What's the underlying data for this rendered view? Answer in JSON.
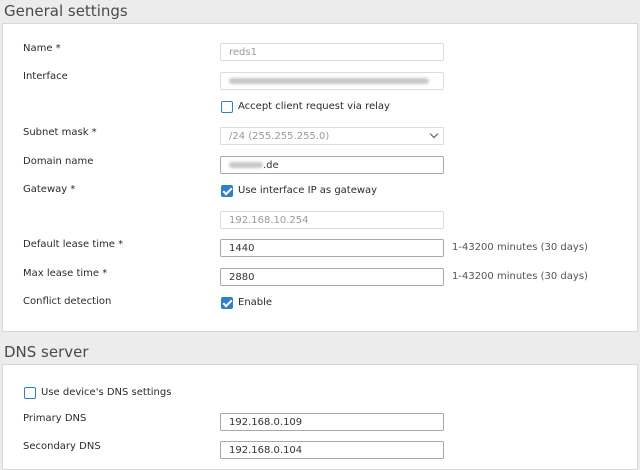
{
  "general": {
    "title": "General settings",
    "name_label": "Name *",
    "name_value": "reds1",
    "interface_label": "Interface",
    "relay_label": "Accept client request via relay",
    "subnet_label": "Subnet mask *",
    "subnet_value": "/24 (255.255.255.0)",
    "domain_label": "Domain name",
    "domain_suffix": ".de",
    "gateway_label": "Gateway *",
    "gateway_check_label": "Use interface IP as gateway",
    "gateway_value": "192.168.10.254",
    "default_lease_label": "Default lease time *",
    "default_lease_value": "1440",
    "default_lease_hint": "1-43200 minutes (30 days)",
    "max_lease_label": "Max lease time *",
    "max_lease_value": "2880",
    "max_lease_hint": "1-43200 minutes (30 days)",
    "conflict_label": "Conflict detection",
    "conflict_check_label": "Enable"
  },
  "dns": {
    "title": "DNS server",
    "device_dns_label": "Use device's DNS settings",
    "primary_label": "Primary DNS",
    "primary_value": "192.168.0.109",
    "secondary_label": "Secondary DNS",
    "secondary_value": "192.168.0.104"
  }
}
